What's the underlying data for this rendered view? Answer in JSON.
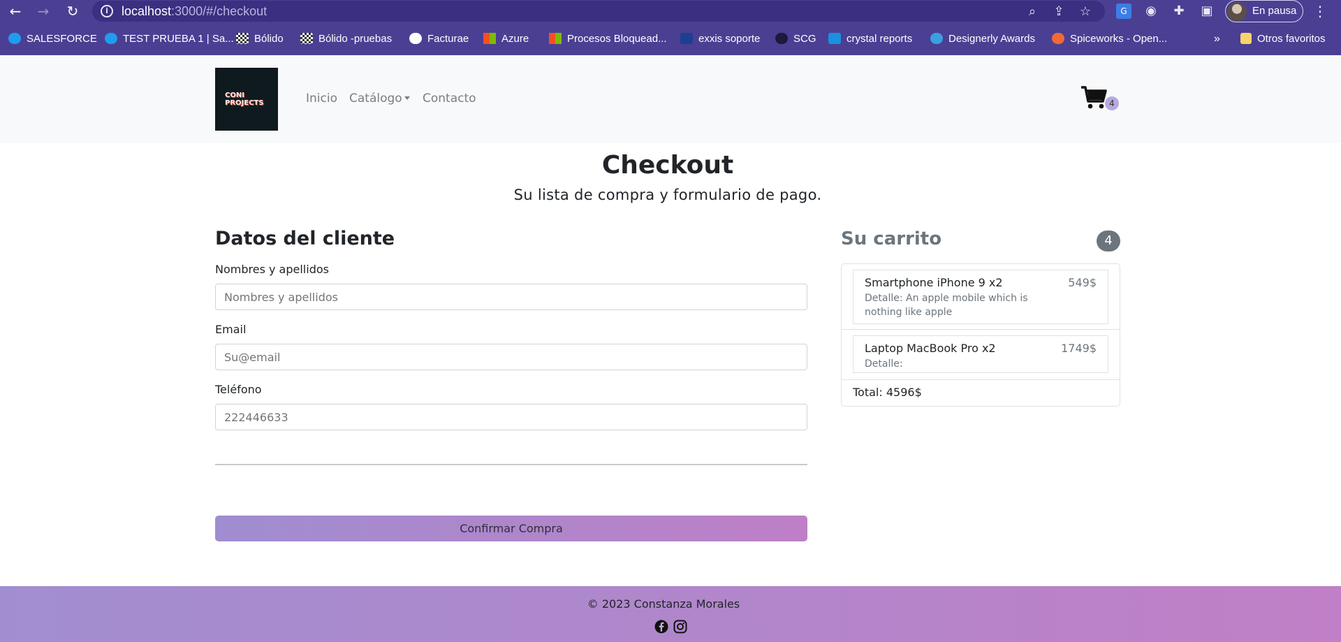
{
  "browser": {
    "url_host": "localhost",
    "url_rest": ":3000/#/checkout",
    "profile_label": "En pausa",
    "bookmarks": [
      {
        "label": "SALESFORCE",
        "icon": "salesforce-icon",
        "color": "#1f9cf0"
      },
      {
        "label": "TEST PRUEBA 1 | Sa...",
        "icon": "salesforce-icon",
        "color": "#1f9cf0"
      },
      {
        "label": "Bólido",
        "icon": "checker-flag-icon",
        "color": "#ffffff"
      },
      {
        "label": "Bólido -pruebas",
        "icon": "checker-flag-icon",
        "color": "#ffffff"
      },
      {
        "label": "Facturae",
        "icon": "facturae-icon",
        "color": "#ffffff"
      },
      {
        "label": "Azure",
        "icon": "microsoft-icon",
        "color": "#f25022"
      },
      {
        "label": "Procesos Bloquead...",
        "icon": "microsoft-icon",
        "color": "#f25022"
      },
      {
        "label": "exxis soporte",
        "icon": "exxis-icon",
        "color": "#1d3f8f"
      },
      {
        "label": "SCG",
        "icon": "scg-icon",
        "color": "#1a1a3a"
      },
      {
        "label": "crystal reports",
        "icon": "sap-icon",
        "color": "#1b8fe0"
      },
      {
        "label": "Designerly Awards",
        "icon": "designerly-icon",
        "color": "#3aa0e0"
      },
      {
        "label": "Spiceworks - Open...",
        "icon": "spiceworks-icon",
        "color": "#f06a35"
      }
    ],
    "more_bookmarks": "»",
    "other_favorites": "Otros favoritos"
  },
  "navbar": {
    "logo_text": "CONI\nPROJECTS",
    "links": [
      "Inicio",
      "Catálogo",
      "Contacto"
    ],
    "cart_count": "4"
  },
  "header": {
    "title": "Checkout",
    "subtitle": "Su lista de compra y formulario de pago."
  },
  "form": {
    "title": "Datos del cliente",
    "fields": [
      {
        "label": "Nombres y apellidos",
        "placeholder": "Nombres y apellidos"
      },
      {
        "label": "Email",
        "placeholder": "Su@email"
      },
      {
        "label": "Teléfono",
        "placeholder": "222446633"
      }
    ],
    "confirm_label": "Confirmar Compra"
  },
  "cart": {
    "title": "Su carrito",
    "count": "4",
    "items": [
      {
        "name": "Smartphone iPhone 9 x2",
        "price": "549$",
        "detail": "Detalle: An apple mobile which is nothing like apple"
      },
      {
        "name": "Laptop MacBook Pro x2",
        "price": "1749$",
        "detail": "Detalle:"
      }
    ],
    "total": "Total: 4596$"
  },
  "footer": {
    "copyright": "© 2023 Constanza Morales",
    "social_icons": [
      "facebook-icon",
      "instagram-icon"
    ]
  },
  "colors": {
    "chrome_bg": "#4b3f93",
    "navbar_bg": "#f8f9fa",
    "accent_gradient_start": "#a18ed0",
    "accent_gradient_end": "#c07fc6",
    "badge_gray": "#6c757d"
  }
}
